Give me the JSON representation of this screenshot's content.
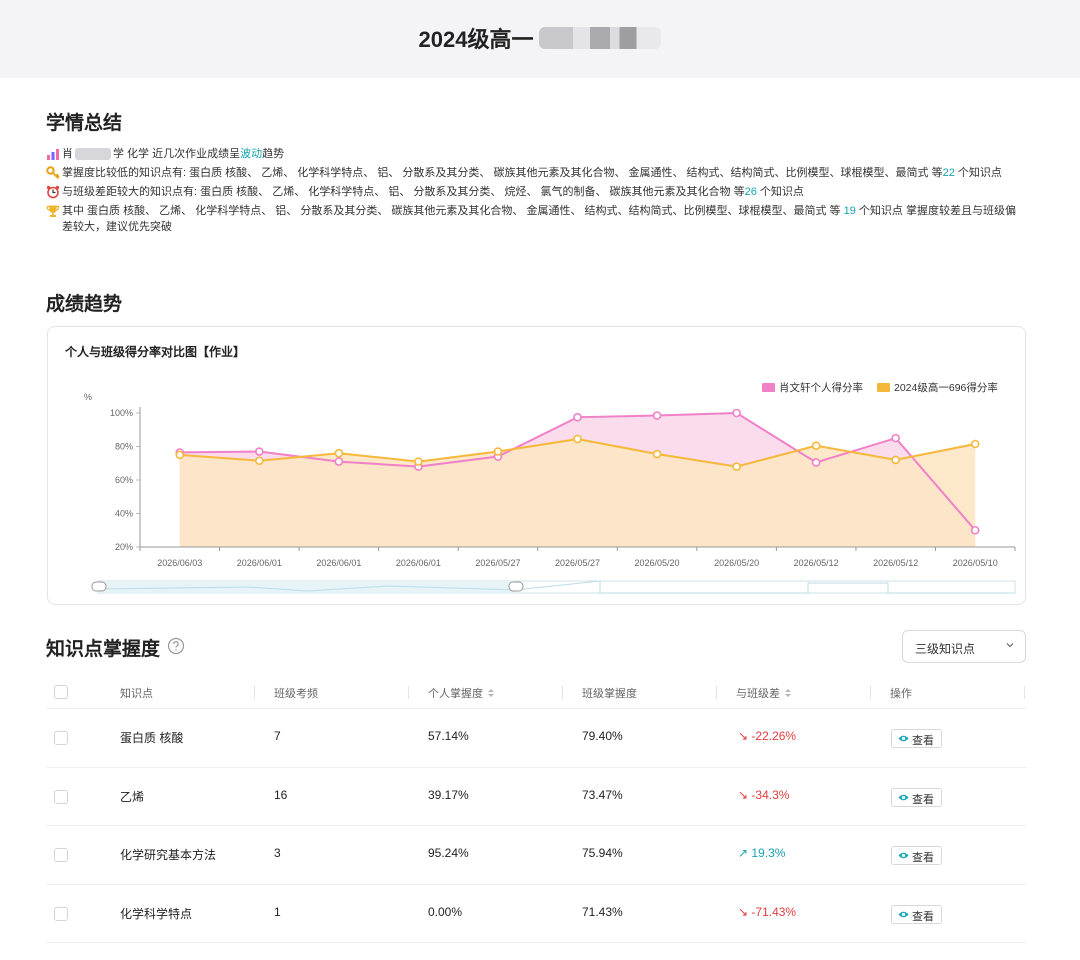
{
  "header": {
    "title": "2024级高一"
  },
  "summary": {
    "title": "学情总结",
    "line1_pre": "肖",
    "line1_mid": "学 化学 近几次作业成绩呈",
    "line1_trend": "波动",
    "line1_post": "趋势",
    "line2_pre": "掌握度比较低的知识点有: 蛋白质 核酸、 乙烯、 化学科学特点、 铝、 分散系及其分类、 碳族其他元素及其化合物、 金属通性、 结构式、结构简式、比例模型、球棍模型、最简式 等",
    "line2_count": "22",
    "line2_post": " 个知识点",
    "line3_pre": "与班级差距较大的知识点有: 蛋白质 核酸、 乙烯、 化学科学特点、 铝、 分散系及其分类、 烷烃、 氯气的制备、 碳族其他元素及其化合物 等",
    "line3_count": "26",
    "line3_post": " 个知识点",
    "line4_pre": "其中 蛋白质 核酸、 乙烯、 化学科学特点、 铝、 分散系及其分类、 碳族其他元素及其化合物、 金属通性、 结构式、结构简式、比例模型、球棍模型、最简式 等",
    "line4_count": "19",
    "line4_post": " 个知识点 掌握度较差且与班级偏差较大，建议优先突破"
  },
  "trend": {
    "title": "成绩趋势",
    "card_title": "个人与班级得分率对比图【作业】",
    "colors": {
      "personal": "#f080c8",
      "class": "#f5b83a",
      "personal_fill": "#f9d6ea",
      "class_fill": "#fde6c4"
    }
  },
  "chart_data": {
    "type": "area",
    "ylabel": "%",
    "yticks": [
      "100%",
      "80%",
      "60%",
      "40%",
      "20%"
    ],
    "ylim": [
      20,
      100
    ],
    "legend_position": "top-right",
    "categories": [
      "2026/06/03",
      "2026/06/01",
      "2026/06/01",
      "2026/06/01",
      "2026/05/27",
      "2026/05/27",
      "2026/05/20",
      "2026/05/20",
      "2026/05/12",
      "2026/05/12",
      "2026/05/10"
    ],
    "series": [
      {
        "name": "肖文轩个人得分率",
        "values": [
          76.5,
          77,
          71,
          68,
          74,
          97.5,
          98.5,
          100,
          70.5,
          85,
          30
        ]
      },
      {
        "name": "2024级高一696得分率",
        "values": [
          75,
          71.5,
          76,
          71,
          77,
          84.5,
          75.5,
          68,
          80.5,
          72,
          81.5
        ]
      }
    ]
  },
  "knowledge": {
    "title": "知识点掌握度",
    "select_value": "三级知识点",
    "headers": {
      "name": "知识点",
      "freq": "班级考频",
      "personal": "个人掌握度",
      "class": "班级掌握度",
      "diff": "与班级差",
      "action": "操作"
    },
    "rows": [
      {
        "name": "蛋白质 核酸",
        "freq": "7",
        "personal": "57.14%",
        "class": "79.40%",
        "diff": "-22.26%",
        "dir": "down",
        "action": "查看"
      },
      {
        "name": "乙烯",
        "freq": "16",
        "personal": "39.17%",
        "class": "73.47%",
        "diff": "-34.3%",
        "dir": "down",
        "action": "查看"
      },
      {
        "name": "化学研究基本方法",
        "freq": "3",
        "personal": "95.24%",
        "class": "75.94%",
        "diff": "19.3%",
        "dir": "up",
        "action": "查看"
      },
      {
        "name": "化学科学特点",
        "freq": "1",
        "personal": "0.00%",
        "class": "71.43%",
        "diff": "-71.43%",
        "dir": "down",
        "action": "查看"
      }
    ]
  }
}
